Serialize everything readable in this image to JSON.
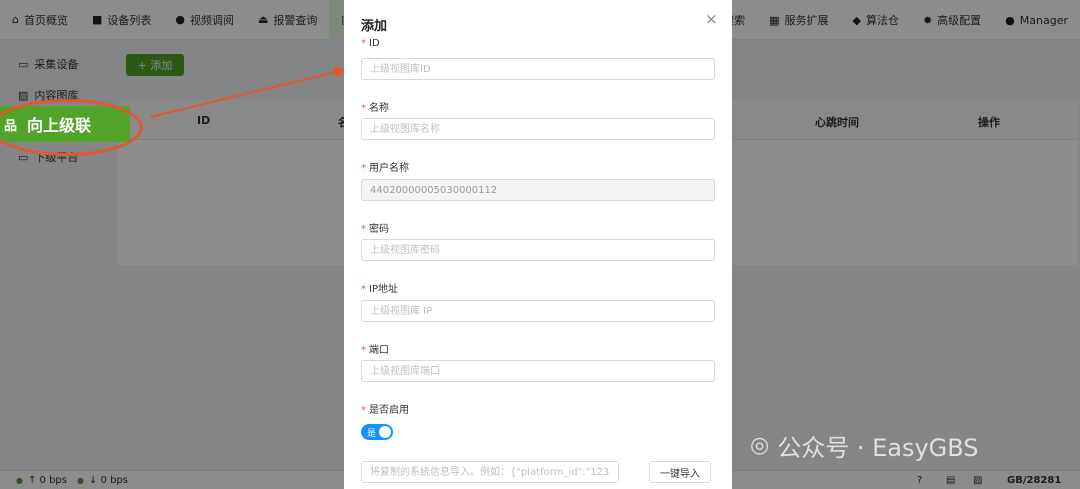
{
  "nav": {
    "items": [
      {
        "icon": "home-icon",
        "glyph": "⌂",
        "label": "首页概览"
      },
      {
        "icon": "device-icon",
        "glyph": "■",
        "label": "设备列表"
      },
      {
        "icon": "play-icon",
        "glyph": "●",
        "label": "视频调阅"
      },
      {
        "icon": "alarm-icon",
        "glyph": "⏏",
        "label": "报警查询"
      },
      {
        "icon": "image-icon",
        "glyph": "▣",
        "label": ""
      }
    ],
    "right_items": [
      {
        "icon": "search-icon",
        "glyph": "",
        "label": "能搜索"
      },
      {
        "icon": "grid-icon",
        "glyph": "▦",
        "label": "服务扩展"
      },
      {
        "icon": "box-icon",
        "glyph": "◆",
        "label": "算法仓"
      },
      {
        "icon": "gear-icon",
        "glyph": "✹",
        "label": "高级配置"
      },
      {
        "icon": "user-icon",
        "glyph": "●",
        "label": "Manager"
      }
    ]
  },
  "sidebar": {
    "items": [
      {
        "icon": "camera-icon",
        "glyph": "▭",
        "label": "采集设备"
      },
      {
        "icon": "gallery-icon",
        "glyph": "▨",
        "label": "内容图库"
      },
      {
        "icon": "monitor-icon",
        "glyph": "▭",
        "label": "下级平台"
      }
    ],
    "active": {
      "icon": "cascade-icon",
      "glyph": "品",
      "label": "向上级联"
    }
  },
  "toolbar": {
    "add_label": "+ 添加"
  },
  "table": {
    "headers": {
      "id": "ID",
      "name": "名",
      "heartbeat": "心跳时间",
      "actions": "操作"
    }
  },
  "status": {
    "up": "↑ 0 bps",
    "down": "↓ 0 bps",
    "version": "GB/28281"
  },
  "modal": {
    "title": "添加",
    "close": "×",
    "fields": {
      "id": {
        "label": "ID",
        "placeholder": "上级视图库ID",
        "value": ""
      },
      "name": {
        "label": "名称",
        "placeholder": "上级视图库名称",
        "value": ""
      },
      "username": {
        "label": "用户名称",
        "placeholder": "",
        "value": "44020000005030000112"
      },
      "password": {
        "label": "密码",
        "placeholder": "上级视图库密码",
        "value": ""
      },
      "ip": {
        "label": "IP地址",
        "placeholder": "上级视图库 IP",
        "value": ""
      },
      "port": {
        "label": "端口",
        "placeholder": "上级视图库端口",
        "value": ""
      },
      "enabled": {
        "label": "是否启用",
        "switch_label": "是",
        "value": true
      }
    },
    "import": {
      "placeholder": "将复制的系统信息导入。例如：{\"platform_id\":\"12312...",
      "button": "一键导入"
    }
  },
  "watermark": {
    "text": "公众号 · EasyGBS"
  },
  "colors": {
    "accent": "#52a32a",
    "switch_on": "#1890ff",
    "annotation": "#e4572e",
    "required": "#ff4d4f"
  }
}
